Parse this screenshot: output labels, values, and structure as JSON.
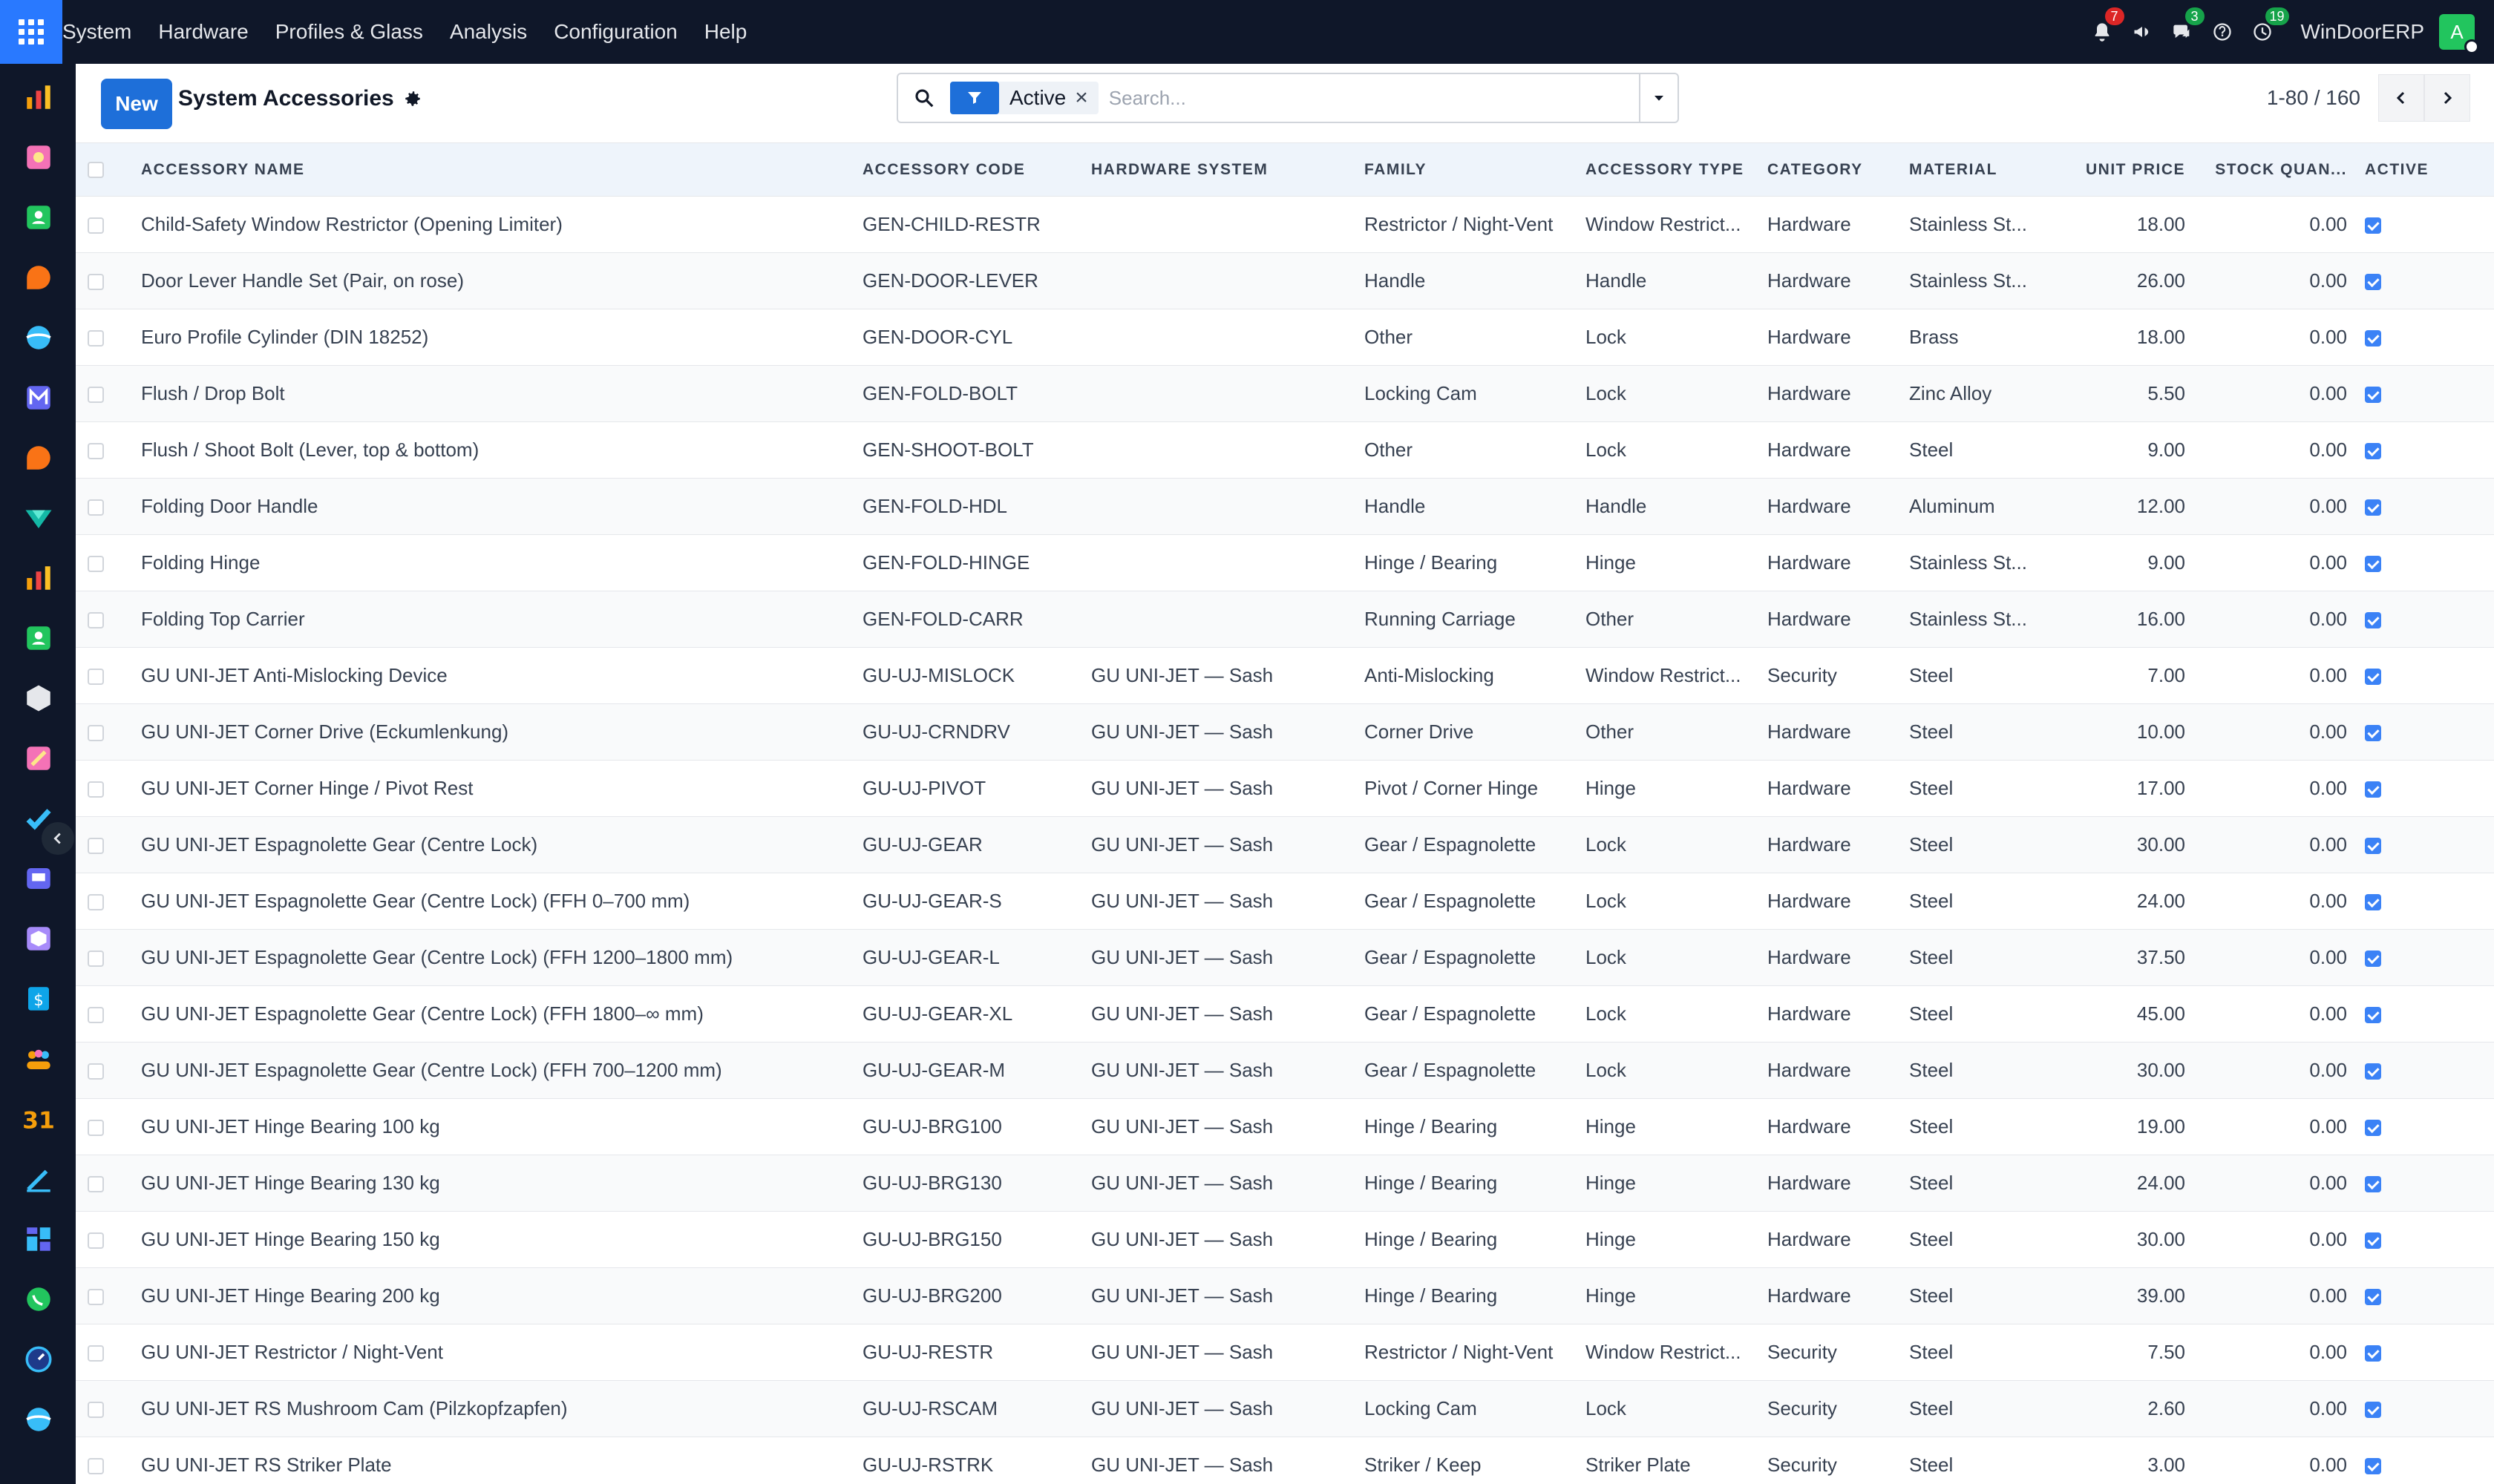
{
  "app": {
    "name": "WinDoorERP",
    "avatar_letter": "A",
    "menu": [
      "System",
      "Hardware",
      "Profiles & Glass",
      "Analysis",
      "Configuration",
      "Help"
    ],
    "icons": [
      {
        "name": "bell-icon",
        "badge": "7",
        "badge_color": "red"
      },
      {
        "name": "megaphone-icon",
        "badge": ""
      },
      {
        "name": "chat-icon",
        "badge": "3",
        "badge_color": "green"
      },
      {
        "name": "help-icon",
        "badge": ""
      },
      {
        "name": "clock-icon",
        "badge": "19",
        "badge_color": "green"
      }
    ]
  },
  "sidebar": {
    "apps": [
      {
        "name": "dashboard-app-icon",
        "color": "#f59e0b"
      },
      {
        "name": "documents-app-icon",
        "color": "#f472b6"
      },
      {
        "name": "contacts-app-icon",
        "color": "#22c55e"
      },
      {
        "name": "discuss-app-icon",
        "color": "#f97316"
      },
      {
        "name": "website-app-icon",
        "color": "#38bdf8"
      },
      {
        "name": "email-app-icon",
        "color": "#6366f1"
      },
      {
        "name": "livechat-app-icon",
        "color": "#f97316"
      },
      {
        "name": "inventory-app-icon",
        "color": "#14b8a6"
      },
      {
        "name": "reporting-app-icon",
        "color": "#f59e0b"
      },
      {
        "name": "employees-app-icon",
        "color": "#22c55e"
      },
      {
        "name": "product-app-icon",
        "color": "#e5e7eb"
      },
      {
        "name": "sign-app-icon",
        "color": "#f472b6"
      },
      {
        "name": "project-app-icon",
        "color": "#38bdf8"
      },
      {
        "name": "elearning-app-icon",
        "color": "#6366f1"
      },
      {
        "name": "packaging-app-icon",
        "color": "#a78bfa"
      },
      {
        "name": "invoicing-app-icon",
        "color": "#0ea5e9"
      },
      {
        "name": "team-app-icon",
        "color": "#f59e0b"
      },
      {
        "name": "calendar-app-icon",
        "color": "#f59e0b",
        "label": "31"
      },
      {
        "name": "signature-app-icon",
        "color": "#38bdf8"
      },
      {
        "name": "apps-store-icon",
        "color": "#6366f1"
      },
      {
        "name": "whatsapp-app-icon",
        "color": "#22c55e"
      },
      {
        "name": "timer-app-icon",
        "color": "#38bdf8"
      },
      {
        "name": "web-app-icon",
        "color": "#38bdf8"
      }
    ]
  },
  "control": {
    "new_label": "New",
    "title": "System Accessories",
    "facet_label": "Active",
    "facet_close": "×",
    "search_placeholder": "Search...",
    "pager": "1-80 / 160"
  },
  "table": {
    "columns": [
      "Accessory Name",
      "Accessory Code",
      "Hardware System",
      "Family",
      "Accessory Type",
      "Category",
      "Material",
      "Unit Price",
      "Stock Quan...",
      "Active"
    ],
    "rows": [
      [
        "Child-Safety Window Restrictor (Opening Limiter)",
        "GEN-CHILD-RESTR",
        "",
        "Restrictor / Night-Vent",
        "Window Restrict...",
        "Hardware",
        "Stainless St...",
        "18.00",
        "0.00"
      ],
      [
        "Door Lever Handle Set (Pair, on rose)",
        "GEN-DOOR-LEVER",
        "",
        "Handle",
        "Handle",
        "Hardware",
        "Stainless St...",
        "26.00",
        "0.00"
      ],
      [
        "Euro Profile Cylinder (DIN 18252)",
        "GEN-DOOR-CYL",
        "",
        "Other",
        "Lock",
        "Hardware",
        "Brass",
        "18.00",
        "0.00"
      ],
      [
        "Flush / Drop Bolt",
        "GEN-FOLD-BOLT",
        "",
        "Locking Cam",
        "Lock",
        "Hardware",
        "Zinc Alloy",
        "5.50",
        "0.00"
      ],
      [
        "Flush / Shoot Bolt (Lever, top & bottom)",
        "GEN-SHOOT-BOLT",
        "",
        "Other",
        "Lock",
        "Hardware",
        "Steel",
        "9.00",
        "0.00"
      ],
      [
        "Folding Door Handle",
        "GEN-FOLD-HDL",
        "",
        "Handle",
        "Handle",
        "Hardware",
        "Aluminum",
        "12.00",
        "0.00"
      ],
      [
        "Folding Hinge",
        "GEN-FOLD-HINGE",
        "",
        "Hinge / Bearing",
        "Hinge",
        "Hardware",
        "Stainless St...",
        "9.00",
        "0.00"
      ],
      [
        "Folding Top Carrier",
        "GEN-FOLD-CARR",
        "",
        "Running Carriage",
        "Other",
        "Hardware",
        "Stainless St...",
        "16.00",
        "0.00"
      ],
      [
        "GU UNI-JET Anti-Mislocking Device",
        "GU-UJ-MISLOCK",
        "GU UNI-JET — Sash",
        "Anti-Mislocking",
        "Window Restrict...",
        "Security",
        "Steel",
        "7.00",
        "0.00"
      ],
      [
        "GU UNI-JET Corner Drive (Eckumlenkung)",
        "GU-UJ-CRNDRV",
        "GU UNI-JET — Sash",
        "Corner Drive",
        "Other",
        "Hardware",
        "Steel",
        "10.00",
        "0.00"
      ],
      [
        "GU UNI-JET Corner Hinge / Pivot Rest",
        "GU-UJ-PIVOT",
        "GU UNI-JET — Sash",
        "Pivot / Corner Hinge",
        "Hinge",
        "Hardware",
        "Steel",
        "17.00",
        "0.00"
      ],
      [
        "GU UNI-JET Espagnolette Gear (Centre Lock)",
        "GU-UJ-GEAR",
        "GU UNI-JET — Sash",
        "Gear / Espagnolette",
        "Lock",
        "Hardware",
        "Steel",
        "30.00",
        "0.00"
      ],
      [
        "GU UNI-JET Espagnolette Gear (Centre Lock) (FFH 0–700 mm)",
        "GU-UJ-GEAR-S",
        "GU UNI-JET — Sash",
        "Gear / Espagnolette",
        "Lock",
        "Hardware",
        "Steel",
        "24.00",
        "0.00"
      ],
      [
        "GU UNI-JET Espagnolette Gear (Centre Lock) (FFH 1200–1800 mm)",
        "GU-UJ-GEAR-L",
        "GU UNI-JET — Sash",
        "Gear / Espagnolette",
        "Lock",
        "Hardware",
        "Steel",
        "37.50",
        "0.00"
      ],
      [
        "GU UNI-JET Espagnolette Gear (Centre Lock) (FFH 1800–∞ mm)",
        "GU-UJ-GEAR-XL",
        "GU UNI-JET — Sash",
        "Gear / Espagnolette",
        "Lock",
        "Hardware",
        "Steel",
        "45.00",
        "0.00"
      ],
      [
        "GU UNI-JET Espagnolette Gear (Centre Lock) (FFH 700–1200 mm)",
        "GU-UJ-GEAR-M",
        "GU UNI-JET — Sash",
        "Gear / Espagnolette",
        "Lock",
        "Hardware",
        "Steel",
        "30.00",
        "0.00"
      ],
      [
        "GU UNI-JET Hinge Bearing 100 kg",
        "GU-UJ-BRG100",
        "GU UNI-JET — Sash",
        "Hinge / Bearing",
        "Hinge",
        "Hardware",
        "Steel",
        "19.00",
        "0.00"
      ],
      [
        "GU UNI-JET Hinge Bearing 130 kg",
        "GU-UJ-BRG130",
        "GU UNI-JET — Sash",
        "Hinge / Bearing",
        "Hinge",
        "Hardware",
        "Steel",
        "24.00",
        "0.00"
      ],
      [
        "GU UNI-JET Hinge Bearing 150 kg",
        "GU-UJ-BRG150",
        "GU UNI-JET — Sash",
        "Hinge / Bearing",
        "Hinge",
        "Hardware",
        "Steel",
        "30.00",
        "0.00"
      ],
      [
        "GU UNI-JET Hinge Bearing 200 kg",
        "GU-UJ-BRG200",
        "GU UNI-JET — Sash",
        "Hinge / Bearing",
        "Hinge",
        "Hardware",
        "Steel",
        "39.00",
        "0.00"
      ],
      [
        "GU UNI-JET Restrictor / Night-Vent",
        "GU-UJ-RESTR",
        "GU UNI-JET — Sash",
        "Restrictor / Night-Vent",
        "Window Restrict...",
        "Security",
        "Steel",
        "7.50",
        "0.00"
      ],
      [
        "GU UNI-JET RS Mushroom Cam (Pilzkopfzapfen)",
        "GU-UJ-RSCAM",
        "GU UNI-JET — Sash",
        "Locking Cam",
        "Lock",
        "Security",
        "Steel",
        "2.60",
        "0.00"
      ],
      [
        "GU UNI-JET RS Striker Plate",
        "GU-UJ-RSTRK",
        "GU UNI-JET — Sash",
        "Striker / Keep",
        "Striker Plate",
        "Security",
        "Steel",
        "3.00",
        "0.00"
      ]
    ]
  }
}
